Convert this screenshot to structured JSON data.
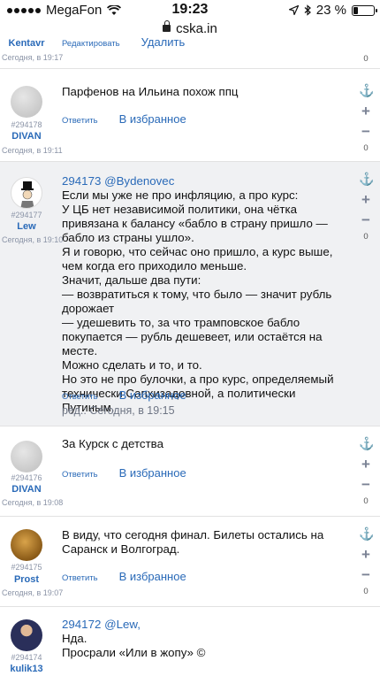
{
  "status": {
    "carrier": "MegaFon",
    "time": "19:23",
    "battery": "23 %",
    "battery_level": 0.23
  },
  "browser": {
    "url": "cska.in"
  },
  "comments": [
    {
      "user": "Kentavr",
      "time": "Сегодня, в 19:17",
      "reply_label": "Редактировать",
      "delete_label": "Удалить",
      "score": "0"
    },
    {
      "number": "#294178",
      "user": "DIVAN",
      "time": "Сегодня, в 19:11",
      "text": "Парфенов на Ильина похож ппц",
      "reply_label": "Ответить",
      "fav_label": "В избранное",
      "score": "0"
    },
    {
      "number": "#294177",
      "user": "Lew",
      "time": "Сегодня, в 19:10",
      "reply_ref": "294173 @Bydenovec",
      "text": "Если мы уже не про инфляцию, а про курс:\nУ ЦБ нет независимой политики, она чётка привязана к балансу «бабло в страну пришло — бабло из страны ушло».\nЯ и говорю, что сейчас оно пришло, а курс выше, чем когда его приходило меньше.\nЗначит, дальше два пути:\n— возвратиться к тому, что было — значит рубль дорожает\n— удешевить то, за что трамповское бабло покупается — рубль дешевеет, или остаётся на месте.\nМожно сделать и то, и то.\nНо это не про булочки, а про курс, определяемый технически Сапхизадовной, а политически Путиным.",
      "reply_label": "Ответить",
      "fav_label": "В избранное",
      "edited": "ред.: Сегодня, в 19:15",
      "score": "0"
    },
    {
      "number": "#294176",
      "user": "DIVAN",
      "time": "Сегодня, в 19:08",
      "text": "За Курск с детства",
      "reply_label": "Ответить",
      "fav_label": "В избранное",
      "score": "0"
    },
    {
      "number": "#294175",
      "user": "Prost",
      "time": "Сегодня, в 19:07",
      "text": "В виду, что сегодня финал. Билеты остались на Саранск и Волгоград.",
      "reply_label": "Ответить",
      "fav_label": "В избранное",
      "score": "0"
    },
    {
      "number": "#294174",
      "user": "kulik13",
      "reply_ref": "294172 @Lew,",
      "text": "Нда.\nПросрали «Или в жопу» ©"
    }
  ],
  "icons": {
    "vote_anchor": "anchor-icon",
    "plus": "plus-icon",
    "minus": "minus-icon"
  }
}
